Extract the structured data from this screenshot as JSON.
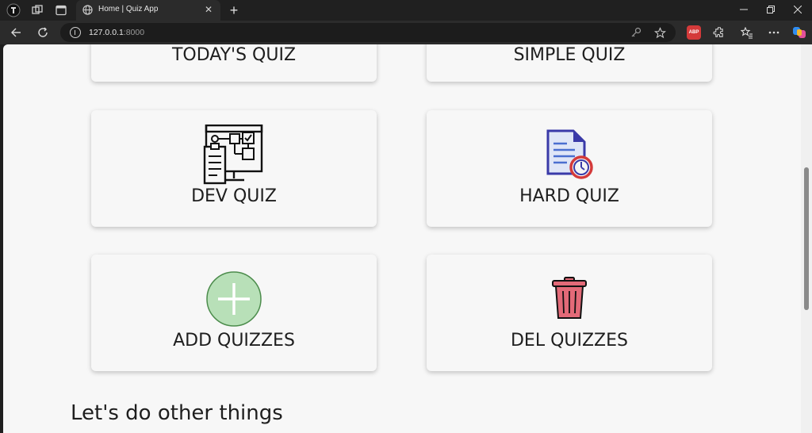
{
  "browser": {
    "tab": {
      "title": "Home | Quiz App"
    },
    "address": {
      "host": "127.0.0.1",
      "port": ":8000"
    },
    "extension_badge": "ABP"
  },
  "quiz_cards": [
    {
      "label": "TODAY'S QUIZ",
      "icon": "calendar-quiz-icon"
    },
    {
      "label": "SIMPLE QUIZ",
      "icon": "simple-quiz-icon"
    },
    {
      "label": "DEV QUIZ",
      "icon": "flowchart-icon"
    },
    {
      "label": "HARD QUIZ",
      "icon": "document-timer-icon"
    },
    {
      "label": "ADD QUIZZES",
      "icon": "plus-circle-icon"
    },
    {
      "label": "DEL QUIZZES",
      "icon": "trash-can-icon"
    }
  ],
  "section": {
    "heading": "Let's do other things"
  },
  "colors": {
    "plus_circle_fill": "#b8e0b8",
    "trash_fill": "#e36a78",
    "document_fill": "#3a3aa8",
    "timer_ring": "#d43a3a"
  }
}
